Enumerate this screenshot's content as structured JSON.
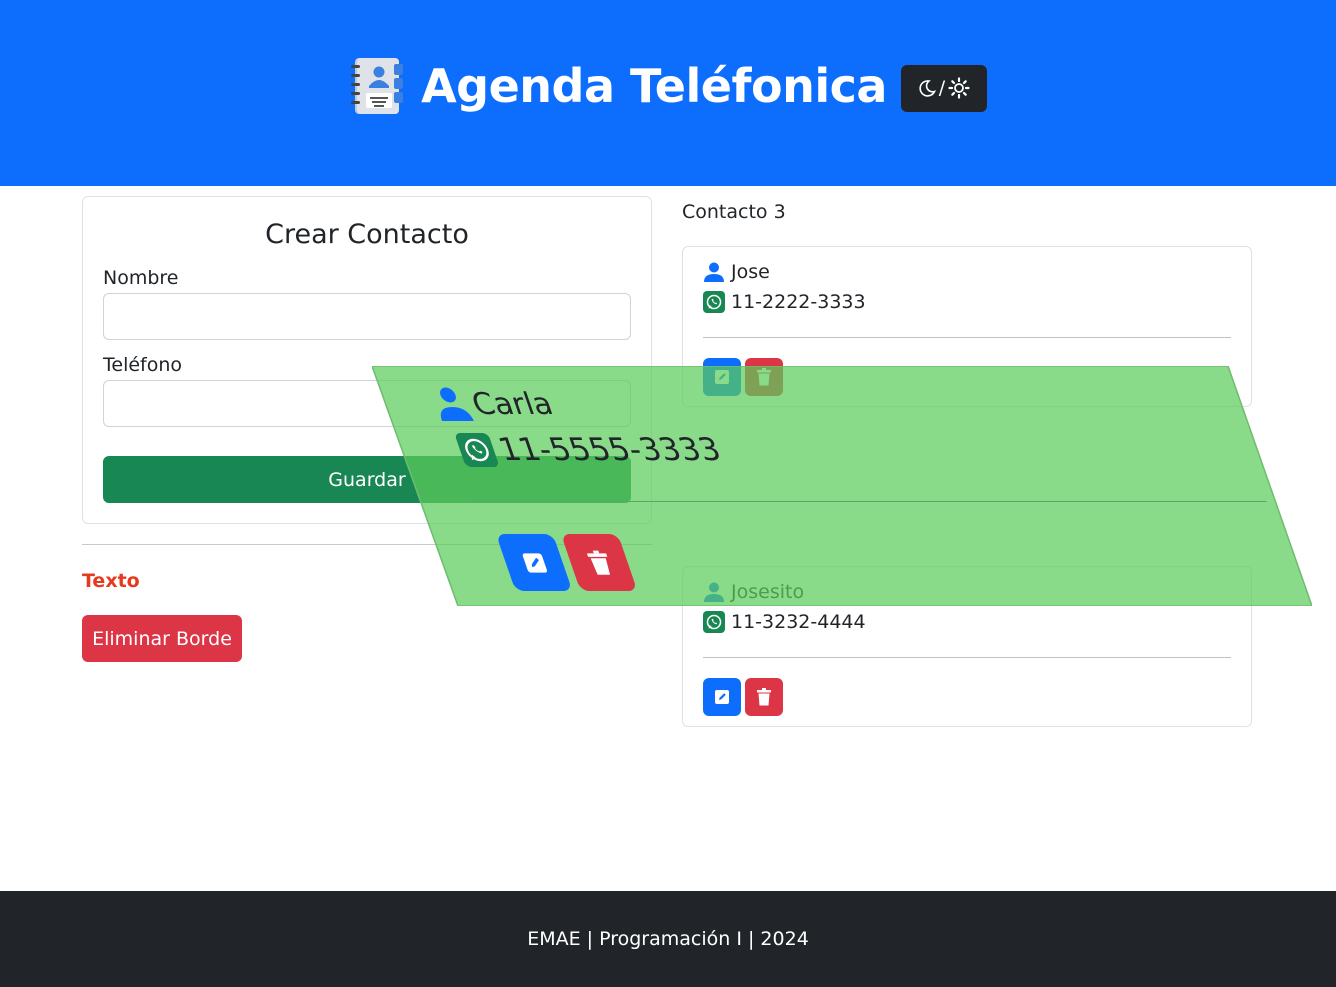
{
  "header": {
    "title": "Agenda Teléfonica",
    "book_icon": "contact-book-icon",
    "theme_toggle": {
      "moon_icon": "moon-icon",
      "separator": "/",
      "sun_icon": "gear-sun-icon"
    }
  },
  "form": {
    "title": "Crear Contacto",
    "name_label": "Nombre",
    "name_value": "",
    "phone_label": "Teléfono",
    "phone_value": "",
    "save_label": "Guardar"
  },
  "texto": "Texto",
  "remove_border_label": "Eliminar Borde",
  "contacts": {
    "heading": "Contacto 3",
    "items": [
      {
        "name": "Jose",
        "phone": "11-2222-3333"
      },
      {
        "name": "Josesito",
        "phone": "11-3232-4444"
      }
    ]
  },
  "dragging": {
    "name": "Carla",
    "phone": "11-5555-3333"
  },
  "colors": {
    "primary": "#0d6efd",
    "success": "#198754",
    "danger": "#dc3545",
    "dark": "#212529",
    "drag_overlay": "#5ccc5c"
  },
  "footer": {
    "text": "EMAE | Programación I | 2024"
  }
}
